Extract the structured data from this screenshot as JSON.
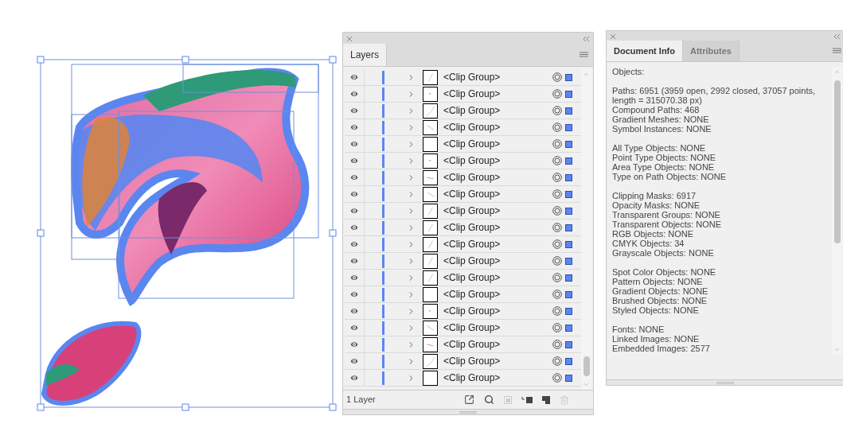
{
  "layers_panel": {
    "tabs": [
      {
        "label": "Layers",
        "selected": true
      }
    ],
    "rows": [
      {
        "label": "<Clip Group>",
        "visible": true,
        "kind": "slash"
      },
      {
        "label": "<Clip Group>",
        "visible": true,
        "kind": "dot"
      },
      {
        "label": "<Clip Group>",
        "visible": true,
        "kind": "curve"
      },
      {
        "label": "<Clip Group>",
        "visible": true,
        "kind": "backslash"
      },
      {
        "label": "<Clip Group>",
        "visible": true,
        "kind": "blank"
      },
      {
        "label": "<Clip Group>",
        "visible": true,
        "kind": "dot"
      },
      {
        "label": "<Clip Group>",
        "visible": true,
        "kind": "dash"
      },
      {
        "label": "<Clip Group>",
        "visible": true,
        "kind": "backslash"
      },
      {
        "label": "<Clip Group>",
        "visible": true,
        "kind": "slash"
      },
      {
        "label": "<Clip Group>",
        "visible": true,
        "kind": "slash"
      },
      {
        "label": "<Clip Group>",
        "visible": true,
        "kind": "slash"
      },
      {
        "label": "<Clip Group>",
        "visible": true,
        "kind": "slash"
      },
      {
        "label": "<Clip Group>",
        "visible": true,
        "kind": "slash"
      },
      {
        "label": "<Clip Group>",
        "visible": true,
        "kind": "blank"
      },
      {
        "label": "<Clip Group>",
        "visible": true,
        "kind": "dot"
      },
      {
        "label": "<Clip Group>",
        "visible": true,
        "kind": "backslash"
      },
      {
        "label": "<Clip Group>",
        "visible": true,
        "kind": "dash"
      },
      {
        "label": "<Clip Group>",
        "visible": true,
        "kind": "curve"
      },
      {
        "label": "<Clip Group>",
        "visible": true,
        "kind": "blank"
      }
    ],
    "footer": {
      "count": "1 Layer"
    }
  },
  "info_panel": {
    "tabs": [
      {
        "label": "Document Info",
        "selected": true
      },
      {
        "label": "Attributes",
        "selected": false
      }
    ],
    "heading": "Objects:",
    "groups": [
      [
        "Paths: 6951 (3959 open, 2992 closed, 37057 points, length = 315070.38 px)",
        "Compound Paths: 468",
        "Gradient Meshes: NONE",
        "Symbol Instances: NONE"
      ],
      [
        "All Type Objects: NONE",
        "Point Type Objects: NONE",
        "Area Type Objects: NONE",
        "Type on Path Objects: NONE"
      ],
      [
        "Clipping Masks: 6917",
        "Opacity Masks: NONE",
        "Transparent Groups: NONE",
        "Transparent Objects: NONE",
        "RGB Objects: NONE",
        "CMYK Objects: 34",
        "Grayscale Objects: NONE"
      ],
      [
        "Spot Color Objects: NONE",
        "Pattern Objects: NONE",
        "Gradient Objects: NONE",
        "Brushed Objects: NONE",
        "Styled Objects: NONE"
      ],
      [
        "Fonts: NONE",
        "Linked Images: NONE",
        "Embedded Images: 2577"
      ]
    ]
  }
}
